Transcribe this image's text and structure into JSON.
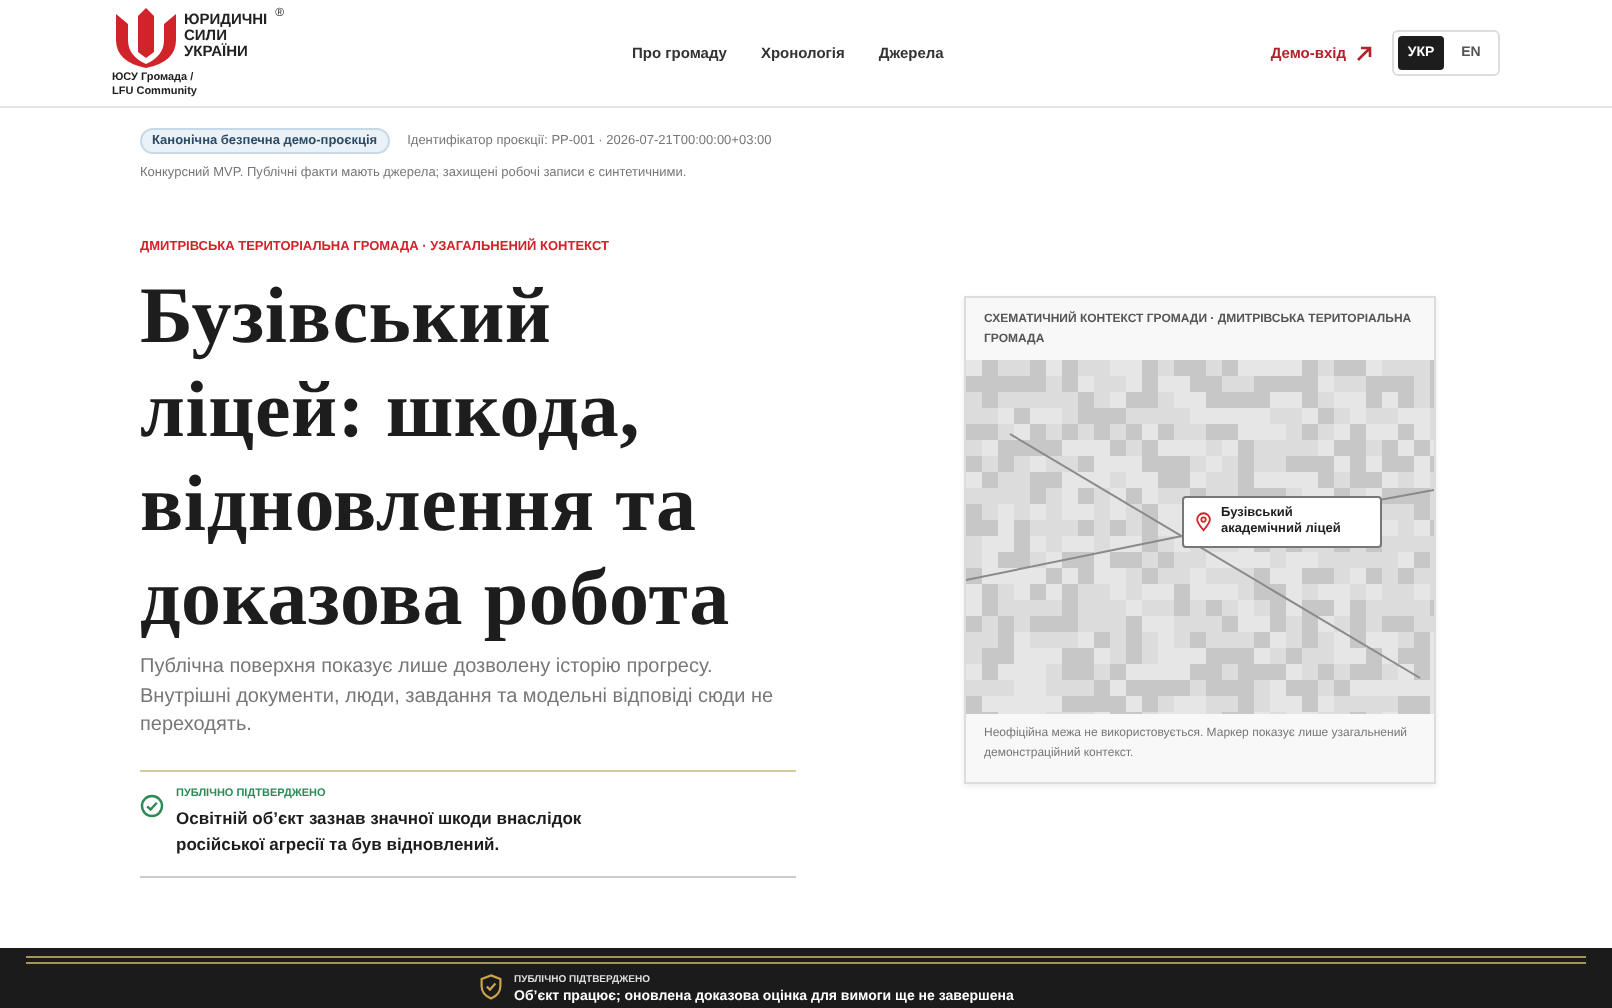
{
  "header": {
    "logo_words": [
      "ЮРИДИЧНІ",
      "СИЛИ",
      "УКРАЇНИ"
    ],
    "logo_mark": "®",
    "logo_caption": [
      "ЮСУ Громада /",
      "LFU Community"
    ],
    "nav": [
      "Про громаду",
      "Хронологія",
      "Джерела"
    ],
    "demo_link": "Демо-вхід",
    "languages": [
      {
        "label": "УКР",
        "selected": true
      },
      {
        "label": "EN",
        "selected": false
      }
    ]
  },
  "projection": {
    "badge": "Канонічна безпечна демо-проєкція",
    "identifier": "Ідентифікатор проєкції: PP-001 · 2026-07-21T00:00:00+03:00",
    "note": "Конкурсний MVP. Публічні факти мають джерела; захищені робочі записи є синтетичними."
  },
  "hero": {
    "kicker": "ДМИТРІВСЬКА ТЕРИТОРІАЛЬНА ГРОМАДА · УЗАГАЛЬНЕНИЙ КОНТЕКСТ",
    "title": "Бузівський ліцей: шкода, відновлення та доказова робота",
    "lead": "Публічна поверхня показує лише дозволену історію прогресу. Внутрішні документи, люди, завдання та модельні відповіді сюди не переходять.",
    "claim": {
      "status": "ПУБЛІЧНО ПІДТВЕРДЖЕНО",
      "text": "Освітній об’єкт зазнав значної шкоди внаслідок російської агресії та був відновлений."
    }
  },
  "map_card": {
    "title": "СХЕМАТИЧНИЙ КОНТЕКСТ ГРОМАДИ · ДМИТРІВСЬКА ТЕРИТОРІАЛЬНА ГРОМАДА",
    "marker_label": "Бузівський академічний ліцей",
    "caption": "Неофіційна межа не використовується. Маркер показує лише узагальнений демонстраційний контекст."
  },
  "bottom_band": {
    "status": "ПУБЛІЧНО ПІДТВЕРДЖЕНО",
    "text": "Об’єкт працює; оновлена доказова оцінка для вимоги ще не завершена"
  }
}
